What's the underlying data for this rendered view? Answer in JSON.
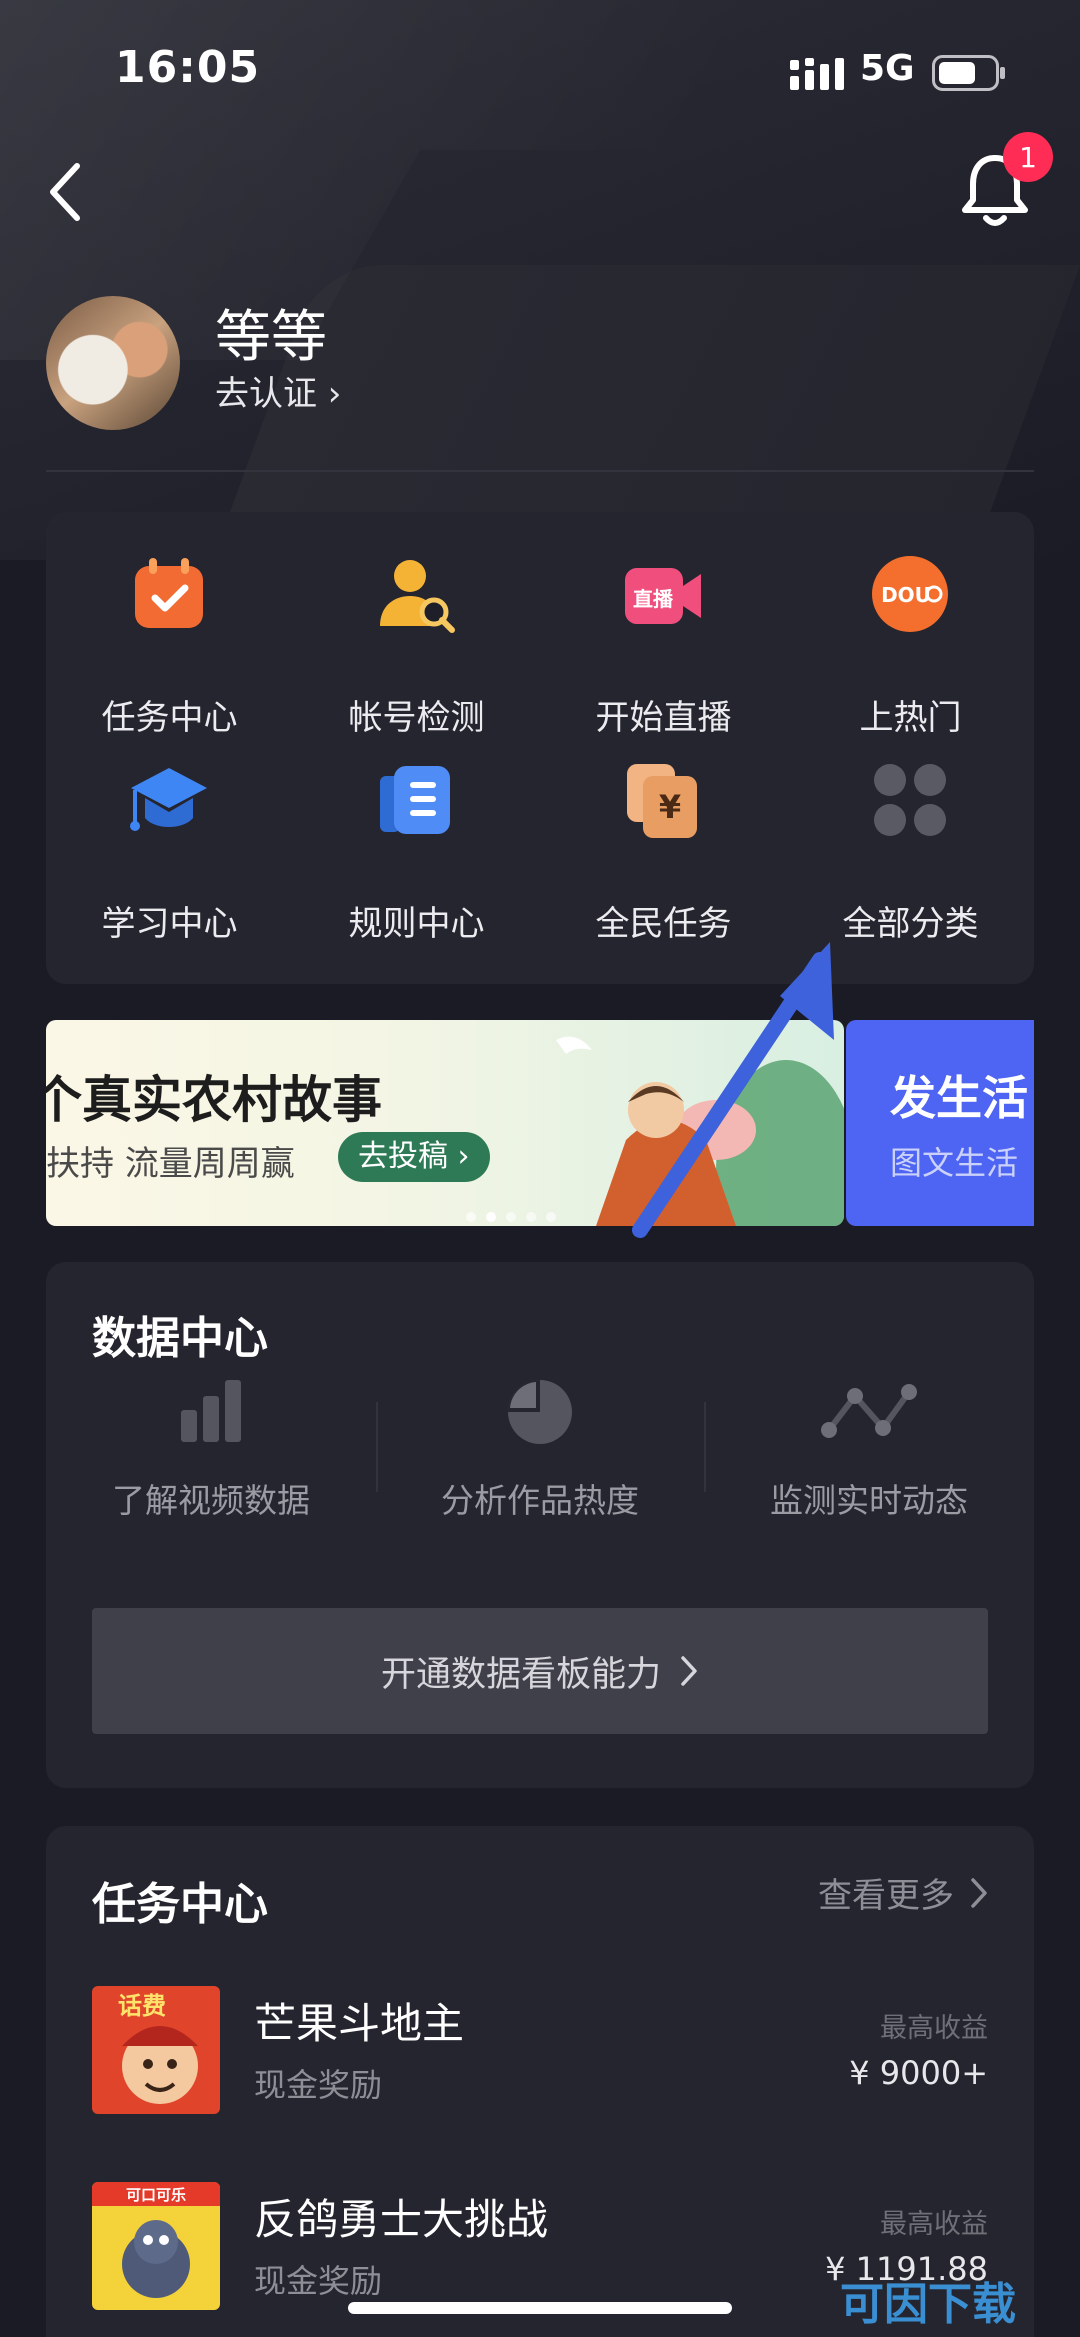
{
  "status": {
    "time": "16:05",
    "network": "5G"
  },
  "header": {
    "notifications": "1"
  },
  "profile": {
    "name": "等等",
    "verify": "去认证 ›"
  },
  "grid": [
    {
      "label": "任务中心",
      "icon": "calendar-check-icon",
      "color": "#f26b33"
    },
    {
      "label": "帐号检测",
      "icon": "user-search-icon",
      "color": "#f5b335"
    },
    {
      "label": "开始直播",
      "icon": "live-camera-icon",
      "color": "#f04f7e",
      "badge": "直播"
    },
    {
      "label": "上热门",
      "icon": "dou-plus-icon",
      "color": "#f46f2e",
      "badge": "DOU"
    },
    {
      "label": "学习中心",
      "icon": "graduation-cap-icon",
      "color": "#3f86f5"
    },
    {
      "label": "规则中心",
      "icon": "rules-book-icon",
      "color": "#4f8cf5"
    },
    {
      "label": "全民任务",
      "icon": "yen-cards-icon",
      "color": "#e89d62",
      "badge": "¥"
    },
    {
      "label": "全部分类",
      "icon": "apps-grid-icon",
      "color": "#5a5a64"
    }
  ],
  "banner": {
    "title": "个真实农村故事",
    "subtitle": "扶持  流量周周赢",
    "button": "去投稿 ›",
    "side_title": "发生活",
    "side_subtitle": "图文生活"
  },
  "data_center": {
    "title": "数据中心",
    "items": [
      {
        "label": "了解视频数据",
        "icon": "bar-chart-icon"
      },
      {
        "label": "分析作品热度",
        "icon": "pie-chart-icon"
      },
      {
        "label": "监测实时动态",
        "icon": "line-trend-icon"
      }
    ],
    "cta": "开通数据看板能力"
  },
  "task_center": {
    "title": "任务中心",
    "more": "查看更多",
    "tasks": [
      {
        "name": "芒果斗地主",
        "tag": "现金奖励",
        "reward_label": "最高收益",
        "reward": "¥ 9000+",
        "thumb_text": "话费"
      },
      {
        "name": "反鸽勇士大挑战",
        "tag": "现金奖励",
        "reward_label": "最高收益",
        "reward": "¥ 1191.88",
        "thumb_text": "可口可乐"
      }
    ]
  },
  "watermark": "可因下载"
}
